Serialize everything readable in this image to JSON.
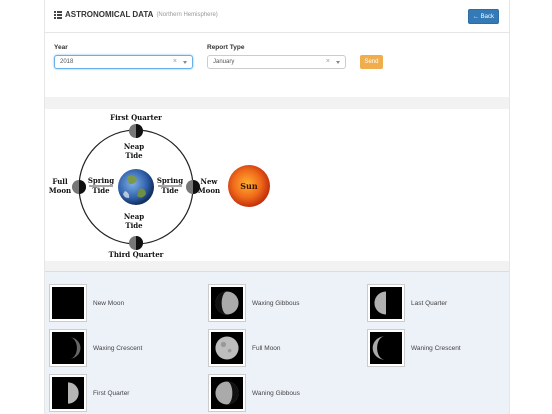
{
  "header": {
    "title": "ASTRONOMICAL DATA",
    "subtitle": "(Northern Hemisphere)",
    "back_label": "← Back"
  },
  "filters": {
    "year_label": "Year",
    "year_value": "2018",
    "report_label": "Report Type",
    "report_value": "January",
    "send_label": "Send",
    "clear_glyph": "×"
  },
  "diagram": {
    "first_quarter": "First Quarter",
    "third_quarter": "Third Quarter",
    "neap_tide_1": "Neap",
    "neap_tide_2": "Tide",
    "spring_1": "Spring",
    "spring_2": "Tide",
    "full_1": "Full",
    "full_2": "Moon",
    "new_1": "New",
    "new_2": "Moon",
    "sun": "Sun"
  },
  "phases": [
    {
      "name": "New Moon",
      "icon": "new-moon-icon"
    },
    {
      "name": "Waxing Gibbous",
      "icon": "waxing-gibbous-icon"
    },
    {
      "name": "Last Quarter",
      "icon": "last-quarter-icon"
    },
    {
      "name": "Waxing Crescent",
      "icon": "waxing-crescent-icon"
    },
    {
      "name": "Full Moon",
      "icon": "full-moon-icon"
    },
    {
      "name": "Waning Crescent",
      "icon": "waning-crescent-icon"
    },
    {
      "name": "First Quarter",
      "icon": "first-quarter-icon"
    },
    {
      "name": "Waning Gibbous",
      "icon": "waning-gibbous-icon"
    }
  ],
  "colors": {
    "back_button": "#337ab7",
    "send_button": "#f0ad4e",
    "phase_bg": "#edf1f8",
    "sun": "#e8541a"
  }
}
